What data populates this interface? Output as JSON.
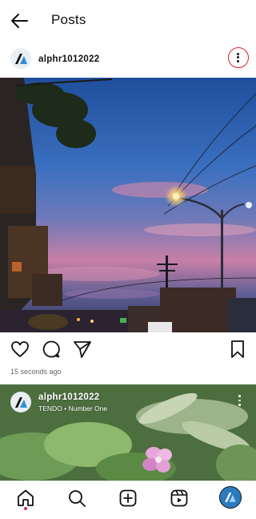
{
  "header": {
    "title": "Posts",
    "back_icon": "arrow-left-icon"
  },
  "post": {
    "username": "alphr1012022",
    "more_icon": "more-vertical-icon",
    "timestamp": "15 seconds ago",
    "actions": [
      "heart-icon",
      "comment-icon",
      "share-icon",
      "bookmark-icon"
    ]
  },
  "next_post": {
    "username": "alphr1012022",
    "music": "TENDO • Number One"
  },
  "bottom_nav": [
    "home-icon",
    "search-icon",
    "create-icon",
    "reels-icon",
    "profile-avatar"
  ],
  "colors": {
    "highlight": "#d9262b",
    "sky_top": "#2c5ba6",
    "sky_pink": "#c77fa6",
    "notification_dot": "#e0245e"
  }
}
